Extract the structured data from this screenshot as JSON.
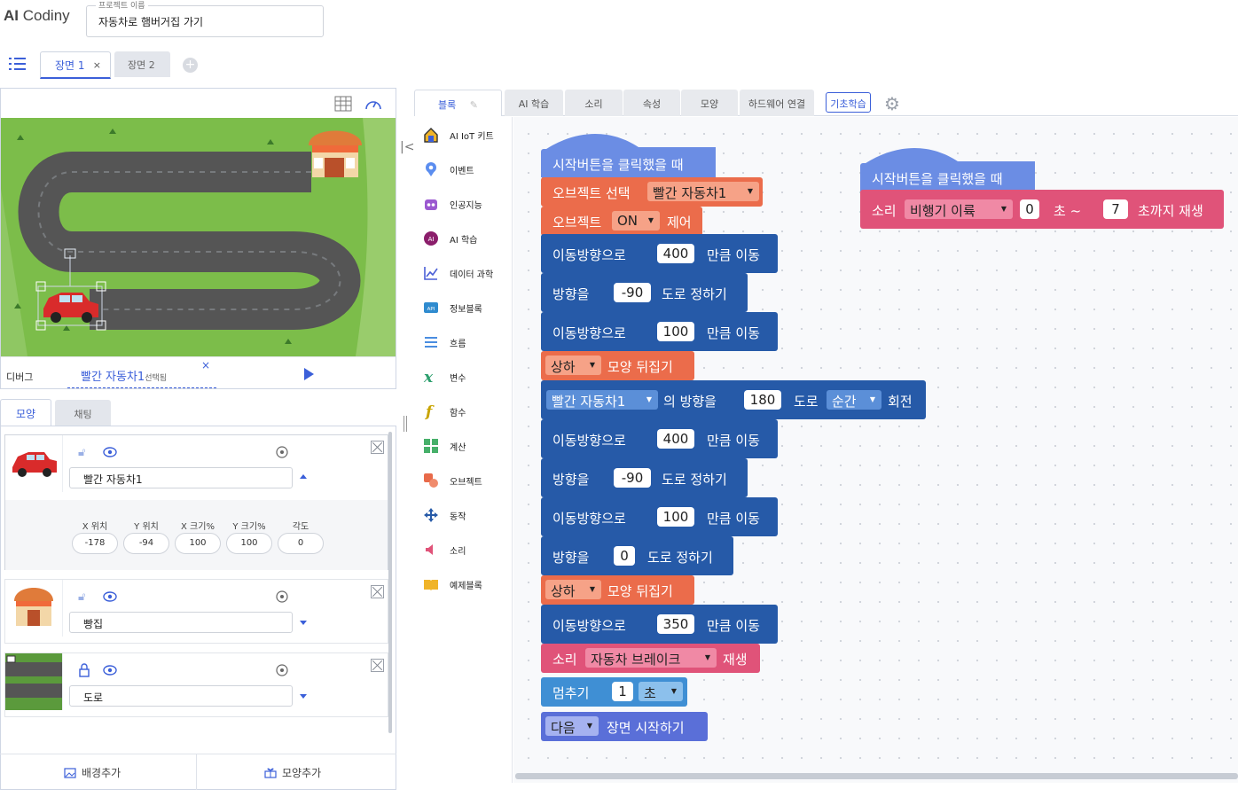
{
  "app": {
    "logo_bold": "AI",
    "logo_rest": "Codiny"
  },
  "project": {
    "label": "프로젝트 이름",
    "name": "자동차로 햄버거집 가기"
  },
  "scenes": {
    "tab1": "장면 1",
    "tab1_close": "×",
    "tab2": "장면 2",
    "add": "+"
  },
  "stage_bar": {
    "debug": "디버그",
    "object": "빨간 자동차1",
    "selected": "선택됨",
    "close": "×"
  },
  "left_tabs": {
    "shape": "모양",
    "chat": "채팅"
  },
  "objects": [
    {
      "name": "빨간 자동차1",
      "props": {
        "labels": [
          "X 위치",
          "Y 위치",
          "X 크기%",
          "Y 크기%",
          "각도"
        ],
        "values": [
          "-178",
          "-94",
          "100",
          "100",
          "0"
        ]
      }
    },
    {
      "name": "빵집"
    },
    {
      "name": "도로"
    }
  ],
  "footer": {
    "add_bg": "배경추가",
    "add_shape": "모양추가"
  },
  "editor_tabs": [
    "블록",
    "AI 학습",
    "소리",
    "속성",
    "모양",
    "하드웨어 연결"
  ],
  "basic_learning": "기초학습",
  "categories": [
    "AI IoT 키트",
    "이벤트",
    "인공지능",
    "AI 학습",
    "데이터 과학",
    "정보블록",
    "흐름",
    "변수",
    "함수",
    "계산",
    "오브젝트",
    "동작",
    "소리",
    "예제블록"
  ],
  "script1": {
    "hat": "시작버튼을 클릭했을 때",
    "select_obj": {
      "text": "오브젝트 선택",
      "value": "빨간 자동차1"
    },
    "obj_ctrl": {
      "a": "오브젝트",
      "value": "ON",
      "b": "제어"
    },
    "move1": {
      "a": "이동방향으로",
      "value": "400",
      "b": "만큼 이동"
    },
    "dir1": {
      "a": "방향을",
      "value": "-90",
      "b": "도로 정하기"
    },
    "move2": {
      "a": "이동방향으로",
      "value": "100",
      "b": "만큼 이동"
    },
    "flip1": {
      "value": "상하",
      "b": "모양 뒤집기"
    },
    "rotate": {
      "target": "빨간 자동차1",
      "a": "의 방향을",
      "value": "180",
      "b": "도로",
      "mode": "순간",
      "c": "회전"
    },
    "move3": {
      "a": "이동방향으로",
      "value": "400",
      "b": "만큼 이동"
    },
    "dir2": {
      "a": "방향을",
      "value": "-90",
      "b": "도로 정하기"
    },
    "move4": {
      "a": "이동방향으로",
      "value": "100",
      "b": "만큼 이동"
    },
    "dir3": {
      "a": "방향을",
      "value": "0",
      "b": "도로 정하기"
    },
    "flip2": {
      "value": "상하",
      "b": "모양 뒤집기"
    },
    "move5": {
      "a": "이동방향으로",
      "value": "350",
      "b": "만큼 이동"
    },
    "sound1": {
      "a": "소리",
      "value": "자동차 브레이크",
      "b": "재생"
    },
    "wait": {
      "a": "멈추기",
      "value": "1",
      "unit": "초"
    },
    "next": {
      "value": "다음",
      "b": "장면 시작하기"
    }
  },
  "script2": {
    "hat": "시작버튼을 클릭했을 때",
    "sound": {
      "a": "소리",
      "value": "비행기 이륙",
      "from": "0",
      "mid": "초 ~",
      "to": "7",
      "b": "초까지 재생"
    }
  }
}
